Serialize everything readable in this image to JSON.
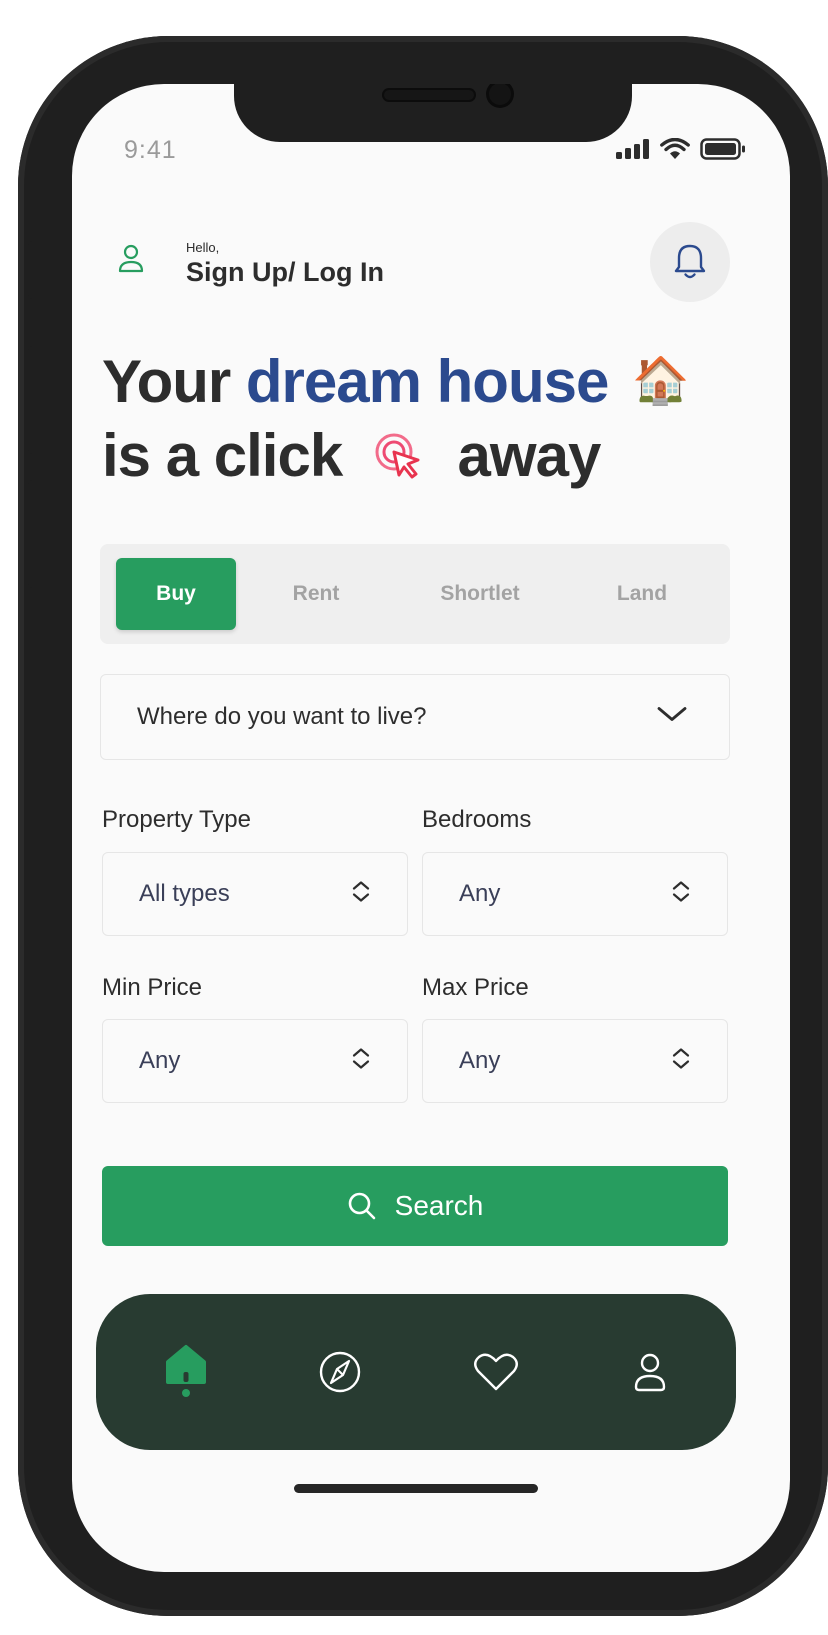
{
  "status_bar": {
    "time": "9:41"
  },
  "header": {
    "greeting": "Hello,",
    "auth_link": "Sign Up/ Log In"
  },
  "hero": {
    "line1_part1": "Your ",
    "line1_accent": "dream house",
    "line1_emoji": "🏠",
    "line2_part1": "is a click",
    "line2_part2": "away"
  },
  "tabs": [
    {
      "label": "Buy",
      "active": true
    },
    {
      "label": "Rent",
      "active": false
    },
    {
      "label": "Shortlet",
      "active": false
    },
    {
      "label": "Land",
      "active": false
    }
  ],
  "location": {
    "placeholder": "Where do you want to live?"
  },
  "filters": {
    "property_type": {
      "label": "Property Type",
      "value": "All types"
    },
    "bedrooms": {
      "label": "Bedrooms",
      "value": "Any"
    },
    "min_price": {
      "label": "Min Price",
      "value": "Any"
    },
    "max_price": {
      "label": "Max Price",
      "value": "Any"
    }
  },
  "search": {
    "label": "Search"
  },
  "bottom_nav": [
    {
      "icon": "home-icon",
      "active": true
    },
    {
      "icon": "compass-icon",
      "active": false
    },
    {
      "icon": "heart-icon",
      "active": false
    },
    {
      "icon": "profile-icon",
      "active": false
    }
  ],
  "colors": {
    "primary_green": "#279d5f",
    "accent_blue": "#2b4a8e",
    "nav_background": "#283b31"
  }
}
